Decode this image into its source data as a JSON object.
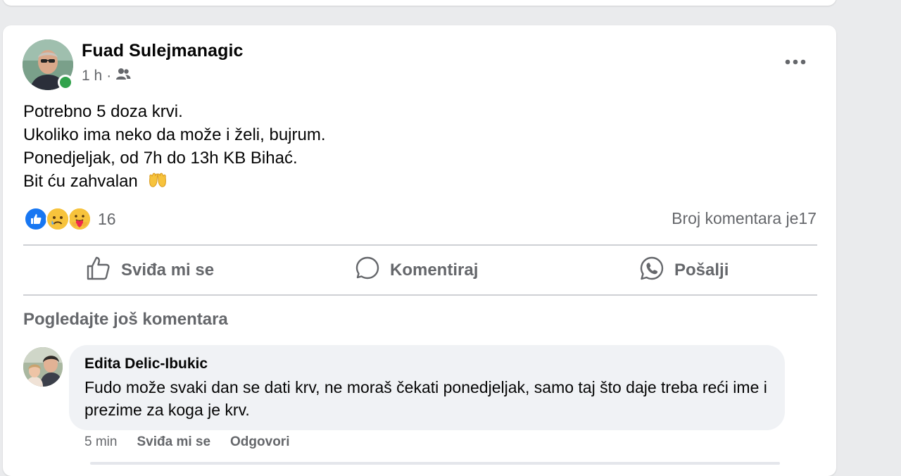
{
  "post": {
    "author": "Fuad Sulejmanagic",
    "time": "1 h",
    "separator": "·",
    "audience_icon": "friends-icon",
    "more_icon": "more-dots-icon",
    "lines": [
      "Potrebno 5 doza krvi.",
      "Ukoliko ima neko da može i želi, bujrum.",
      "Ponedjeljak, od 7h do 13h KB Bihać.",
      "Bit ću zahvalan"
    ],
    "emoji": "open-hands-emoji",
    "reactions": {
      "icons": [
        "like-reaction-icon",
        "sad-reaction-icon",
        "care-reaction-icon"
      ],
      "count": "16"
    },
    "comment_count": "Broj komentara je17"
  },
  "actions": {
    "like": "Sviđa mi se",
    "comment": "Komentiraj",
    "send": "Pošalji"
  },
  "view_more_comments": "Pogledajte još komentara",
  "comment": {
    "author": "Edita Delic-Ibukic",
    "text": "Fudo može svaki dan se dati krv, ne moraš čekati ponedjeljak, samo taj što daje treba reći ime i prezime za koga je krv.",
    "time": "5 min",
    "like": "Sviđa mi se",
    "reply": "Odgovori"
  },
  "colors": {
    "background": "#eaebed",
    "card": "#ffffff",
    "secondary_text": "#65676b",
    "bubble": "#f0f2f5",
    "online": "#31a24c",
    "like_blue": "#1877f2"
  }
}
